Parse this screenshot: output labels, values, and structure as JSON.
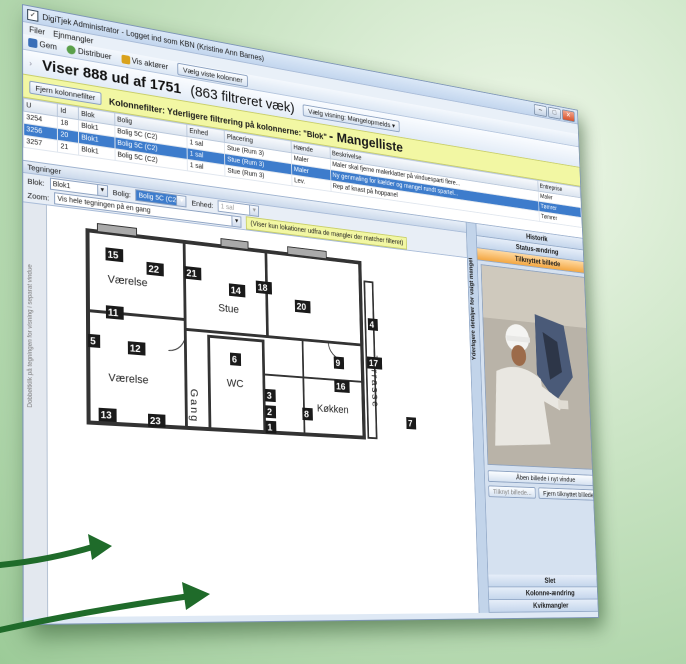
{
  "window": {
    "title": "DigiTjek Administrator - Logget ind som KBN (Kristine Ann Barnes)",
    "controls": [
      "–",
      "□",
      "✕"
    ]
  },
  "menu": [
    "Filer",
    "Ejnmangler"
  ],
  "toolbar": [
    {
      "label": "Gem",
      "icon": "save-icon",
      "color": "#3a6fb8"
    },
    {
      "label": "Distribuer",
      "icon": "distribute-icon",
      "color": "#5aa04a"
    },
    {
      "label": "Vis aktører",
      "icon": "actors-icon",
      "color": "#d9a21c"
    },
    {
      "label": "Vælg viste kolonner",
      "icon": "columns-icon",
      "color": ""
    }
  ],
  "summary": {
    "count_text": "Viser 888 ud af 1751",
    "filtered_text": "(863 filtreret væk)",
    "sort_label": "Vælg visning:",
    "sort_value": "Mangelopmelds"
  },
  "filterbar": {
    "remove_button": "Fjern kolonnefilter",
    "label": "Kolonnefilter: Yderligere filtrering på kolonnerne: \"Blok\"",
    "title": "Mangelliste"
  },
  "grid": {
    "columns": [
      "U",
      "Id",
      "Blok",
      "Bolig",
      "Enhed",
      "Placering",
      "Hænde",
      "Beskrivelse",
      "Entreprise"
    ],
    "rows": [
      [
        "3254",
        "18",
        "Blok1",
        "Bolig 5C (C2)",
        "1 sal",
        "Stue (Rum 3)",
        "Maler",
        "Maler skal fjerne malerklatter på vinduesparti flere...",
        "Maler"
      ],
      [
        "3256",
        "20",
        "Blok1",
        "Bolig 5C (C2)",
        "1 sal",
        "Stue (Rum 3)",
        "Maler",
        "Ny genmaling for kælder og mangel rundt spartel...",
        "Tømrer"
      ],
      [
        "3257",
        "21",
        "Blok1",
        "Bolig 5C (C2)",
        "1 sal",
        "Stue (Rum 3)",
        "Lev.",
        "Rep af knast på hoppanel",
        "Tømrer"
      ]
    ],
    "selected_row": 1
  },
  "tegninger": {
    "title": "Tegninger",
    "blok_label": "Blok:",
    "blok_value": "Blok1",
    "bolig_label": "Bolig:",
    "bolig_value": "Bolig 5C (C2)",
    "enhed_label": "Enhed:",
    "enhed_value": "1 sal",
    "zoom_label": "Zoom:",
    "zoom_value": "Vis hele tegningen på en gang",
    "note": "(Viser kun lokationer udfra de mangler der matcher filteret)",
    "side_text": "Dobbeltklik på tegningen for visning i separat vindue"
  },
  "plan": {
    "rooms": [
      "Værelse",
      "Stue",
      "Værelse",
      "Gang",
      "WC",
      "Køkken",
      "Terrasse"
    ],
    "markers": [
      "15",
      "22",
      "21",
      "14",
      "18",
      "20",
      "4",
      "11",
      "5",
      "12",
      "6",
      "9",
      "17",
      "16",
      "3",
      "8",
      "7",
      "13",
      "23",
      "2",
      "1"
    ]
  },
  "right_panel": {
    "strip_label": "Yderligere detaljer for valgt mangel",
    "tabs_top": [
      "Historik",
      "Status-ændring",
      "Tilknyttet billede"
    ],
    "active_tab": "Tilknyttet billede",
    "open_button": "Åben billede i nyt vindue",
    "attach_button": "Tilknyt billede...",
    "remove_button": "Fjern tilknyttet billede...",
    "tabs_bottom": [
      "Slet",
      "Kolonne-ændring",
      "Kvikmangler"
    ]
  },
  "colors": {
    "accent_blue": "#3d7ccc",
    "filter_yellow": "#f2f7a3",
    "active_tab_orange": "#f3a743",
    "arrow_green": "#1f6b2a"
  }
}
